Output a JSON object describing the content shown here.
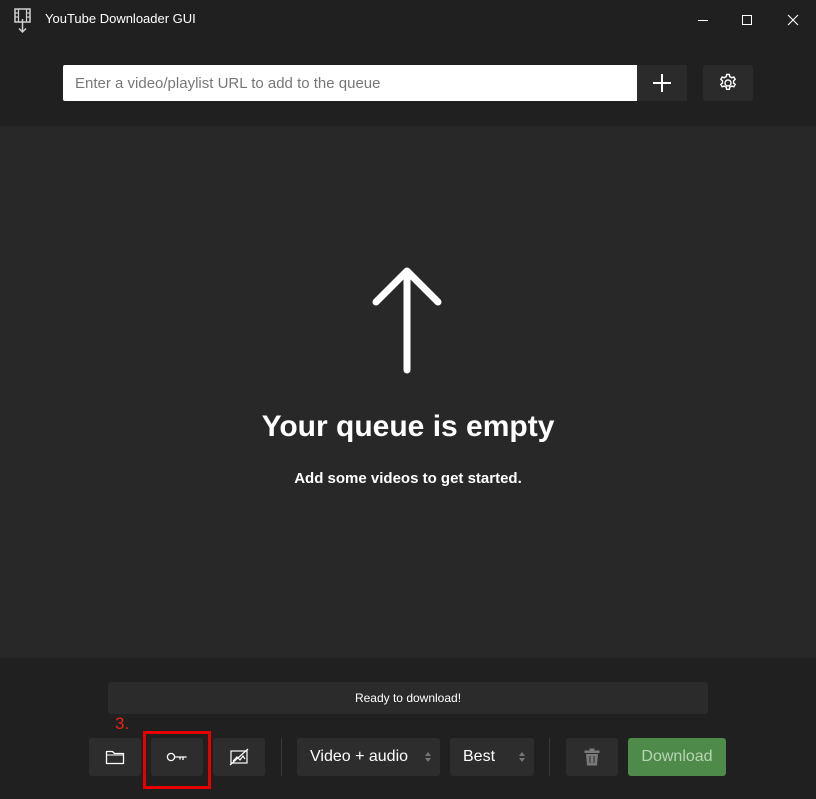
{
  "window": {
    "title": "YouTube Downloader GUI",
    "icon": "film-download-icon"
  },
  "url_bar": {
    "placeholder": "Enter a video/playlist URL to add to the queue",
    "value": "",
    "add_icon": "plus-icon",
    "settings_icon": "gear-icon"
  },
  "queue": {
    "icon": "up-arrow-icon",
    "empty_title": "Your queue is empty",
    "empty_subtitle": "Add some videos to get started."
  },
  "status": {
    "text": "Ready to download!"
  },
  "annotation": {
    "step_label": "3.",
    "color": "#e60000"
  },
  "toolbar": {
    "folder_icon": "folder-icon",
    "cookies_icon": "key-icon",
    "thumbnail_icon": "no-image-icon",
    "format_selected": "Video + audio",
    "quality_selected": "Best",
    "delete_icon": "trash-icon",
    "download_label": "Download"
  },
  "colors": {
    "background": "#202020",
    "queue_background": "#282828",
    "download_accent": "#4e8b4a"
  }
}
